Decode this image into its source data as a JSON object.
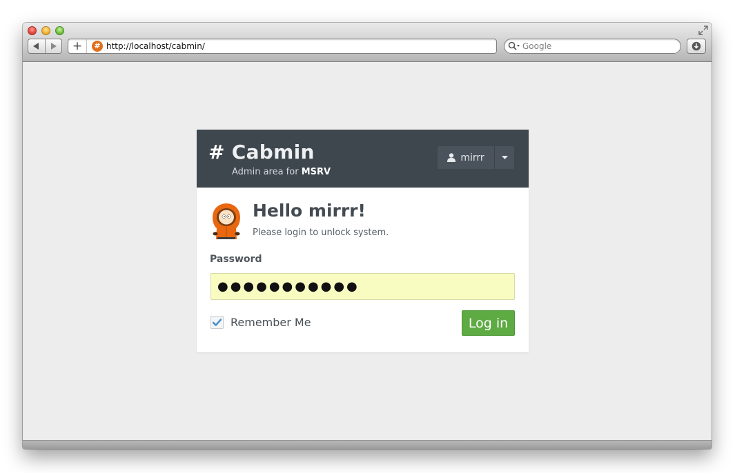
{
  "browser": {
    "url": "http://localhost/cabmin/",
    "add_tab_label": "+",
    "search_placeholder": "Google",
    "icons": {
      "close": "close-traffic-icon",
      "minimize": "minimize-traffic-icon",
      "zoom": "zoom-traffic-icon",
      "back": "back-arrow-icon",
      "forward": "forward-arrow-icon",
      "favicon": "hash-favicon-icon",
      "search": "magnifier-icon",
      "download": "download-icon",
      "fullscreen": "fullscreen-icon"
    }
  },
  "header": {
    "hash": "#",
    "title": "Cabmin",
    "subtitle_prefix": "Admin area for",
    "subtitle_target": "MSRV",
    "user_name": "mirrr",
    "background": "#3e464e"
  },
  "login": {
    "greeting": "Hello mirrr!",
    "hint": "Please login to unlock system.",
    "password_label": "Password",
    "password_value": "●●●●●●●●●●●",
    "remember_label": "Remember Me",
    "remember_checked": true,
    "submit_label": "Log in",
    "input_color": "#f9fcc1",
    "button_color": "#5eaa43"
  }
}
